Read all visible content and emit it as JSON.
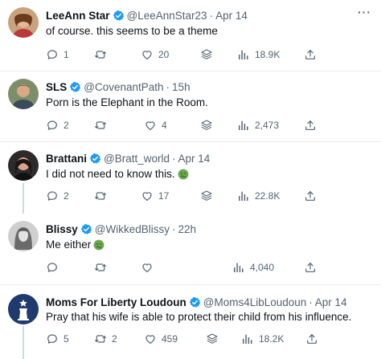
{
  "tweets": [
    {
      "name": "LeeAnn Star",
      "handle": "@LeeAnnStar23",
      "time": "Apr 14",
      "text": "of course. this seems to be a theme",
      "reply_count": "1",
      "retweet_count": "",
      "like_count": "20",
      "view_count": "18.9K"
    },
    {
      "name": "SLS",
      "handle": "@CovenantPath",
      "time": "15h",
      "text": "Porn is the Elephant in the Room.",
      "reply_count": "2",
      "retweet_count": "",
      "like_count": "4",
      "view_count": "2,473"
    },
    {
      "name": "Brattani",
      "handle": "@Bratt_world",
      "time": "Apr 14",
      "text": "I did not need to know this.",
      "reply_count": "2",
      "retweet_count": "",
      "like_count": "17",
      "view_count": "22.8K"
    },
    {
      "name": "Blissy",
      "handle": "@WikkedBlissy",
      "time": "22h",
      "text": "Me either",
      "reply_count": "",
      "retweet_count": "",
      "like_count": "",
      "view_count": "4,040"
    },
    {
      "name": "Moms For Liberty Loudoun",
      "handle": "@Moms4LibLoudoun",
      "time": "Apr 14",
      "text": "Pray that his wife is able to protect their child from his influence.",
      "reply_count": "5",
      "retweet_count": "2",
      "like_count": "459",
      "view_count": "18.2K"
    }
  ],
  "colors": {
    "verified_blue": "#1d9bf0",
    "muted_text": "#536471",
    "primary_text": "#0f1419",
    "nauseated_green": "#6aa84f"
  },
  "icons": [
    "reply-icon",
    "retweet-icon",
    "like-icon",
    "stack-icon",
    "views-icon",
    "share-icon",
    "more-icon",
    "verified-badge-icon",
    "nauseated-face-emoji"
  ]
}
